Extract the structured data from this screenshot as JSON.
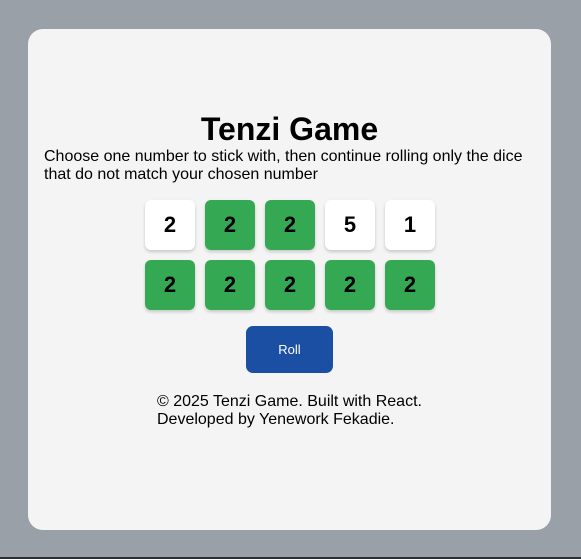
{
  "game": {
    "title": "Tenzi Game",
    "instructions": "Choose one number to stick with, then continue rolling only the dice that do not match your chosen number",
    "dice": [
      {
        "value": "2",
        "held": false
      },
      {
        "value": "2",
        "held": true
      },
      {
        "value": "2",
        "held": true
      },
      {
        "value": "5",
        "held": false
      },
      {
        "value": "1",
        "held": false
      },
      {
        "value": "2",
        "held": true
      },
      {
        "value": "2",
        "held": true
      },
      {
        "value": "2",
        "held": true
      },
      {
        "value": "2",
        "held": true
      },
      {
        "value": "2",
        "held": true
      }
    ],
    "roll_label": "Roll"
  },
  "footer": {
    "line1": "© 2025 Tenzi Game. Built with React.",
    "line2": "Developed by Yenework Fekadie."
  },
  "colors": {
    "background": "#9aa0a8",
    "card": "#f4f4f4",
    "held_die": "#34a853",
    "free_die": "#ffffff",
    "roll_button": "#1a4fa3"
  }
}
